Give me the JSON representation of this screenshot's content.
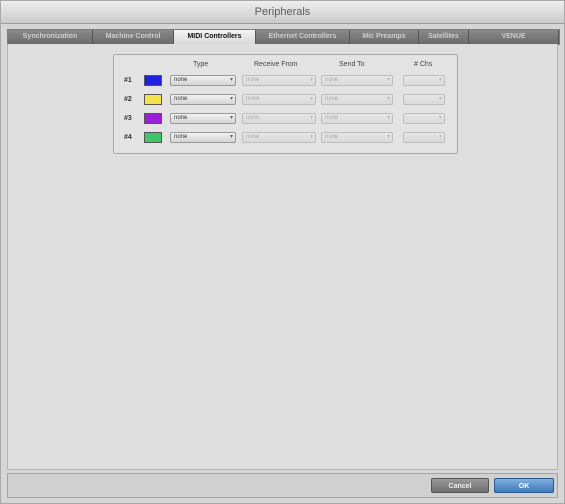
{
  "window": {
    "title": "Peripherals"
  },
  "tabs": [
    {
      "label": "Synchronization",
      "active": false
    },
    {
      "label": "Machine Control",
      "active": false
    },
    {
      "label": "MIDI Controllers",
      "active": true
    },
    {
      "label": "Ethernet Controllers",
      "active": false
    },
    {
      "label": "Mic Preamps",
      "active": false
    },
    {
      "label": "Satellites",
      "active": false
    },
    {
      "label": "VENUE",
      "active": false
    }
  ],
  "midi": {
    "headers": {
      "type": "Type",
      "receive_from": "Receive From",
      "send_to": "Send To",
      "num_chs": "# Chs"
    },
    "rows": [
      {
        "label": "#1",
        "color": "#1f23e0",
        "type": "none",
        "receive_from": "none",
        "send_to": "none",
        "num_chs": ""
      },
      {
        "label": "#2",
        "color": "#f4e24a",
        "type": "none",
        "receive_from": "none",
        "send_to": "none",
        "num_chs": ""
      },
      {
        "label": "#3",
        "color": "#9a1fd8",
        "type": "none",
        "receive_from": "none",
        "send_to": "none",
        "num_chs": ""
      },
      {
        "label": "#4",
        "color": "#3fc46a",
        "type": "none",
        "receive_from": "none",
        "send_to": "none",
        "num_chs": ""
      }
    ]
  },
  "footer": {
    "cancel_label": "Cancel",
    "ok_label": "OK"
  }
}
